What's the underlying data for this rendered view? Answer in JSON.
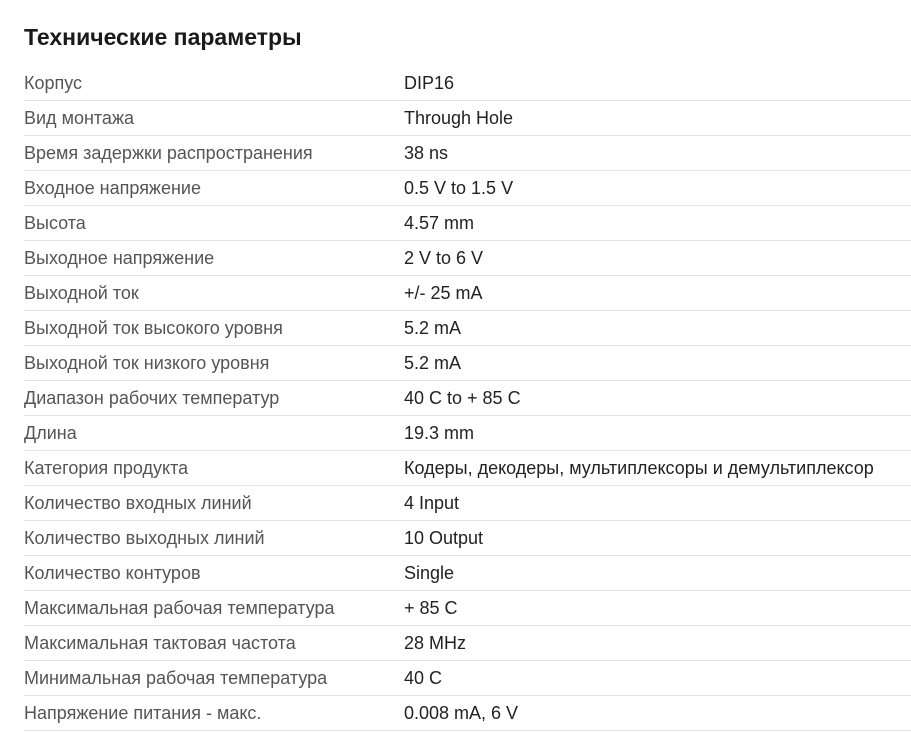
{
  "section": {
    "title": "Технические параметры"
  },
  "specs": [
    {
      "name": "Корпус",
      "value": "DIP16"
    },
    {
      "name": "Вид монтажа",
      "value": "Through Hole"
    },
    {
      "name": "Время задержки распространения",
      "value": "38 ns"
    },
    {
      "name": "Входное напряжение",
      "value": "0.5 V to 1.5 V"
    },
    {
      "name": "Высота",
      "value": "4.57 mm"
    },
    {
      "name": "Выходное напряжение",
      "value": "2 V to 6 V"
    },
    {
      "name": "Выходной ток",
      "value": "+/- 25 mA"
    },
    {
      "name": "Выходной ток высокого уровня",
      "value": "5.2 mA"
    },
    {
      "name": "Выходной ток низкого уровня",
      "value": "5.2 mA"
    },
    {
      "name": "Диапазон рабочих температур",
      "value": "40 C to + 85 C"
    },
    {
      "name": "Длина",
      "value": "19.3 mm"
    },
    {
      "name": "Категория продукта",
      "value": "Кодеры, декодеры, мультиплексоры и демультиплексор"
    },
    {
      "name": "Количество входных линий",
      "value": "4 Input"
    },
    {
      "name": "Количество выходных линий",
      "value": "10 Output"
    },
    {
      "name": "Количество контуров",
      "value": "Single"
    },
    {
      "name": "Максимальная рабочая температура",
      "value": "+ 85 C"
    },
    {
      "name": "Максимальная тактовая частота",
      "value": "28 MHz"
    },
    {
      "name": "Минимальная рабочая температура",
      "value": "40 C"
    },
    {
      "name": "Напряжение питания - макс.",
      "value": "0.008 mA, 6 V"
    }
  ]
}
